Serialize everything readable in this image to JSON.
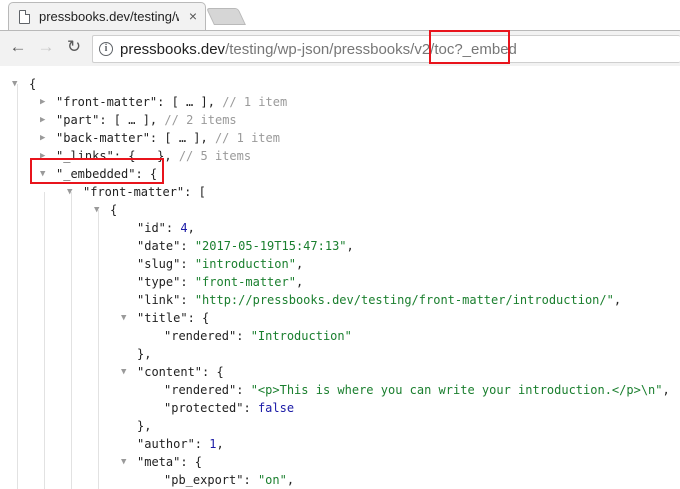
{
  "tab": {
    "title": "pressbooks.dev/testing/w",
    "close": "×"
  },
  "toolbar": {
    "back": "←",
    "forward": "→",
    "reload": "↻",
    "url_host": "pressbooks.dev",
    "url_path": "/testing/wp-json/pressbooks/v2/toc?_embed",
    "info": "i"
  },
  "json": {
    "open_brace": "{",
    "front_matter": {
      "key": "\"front-matter\"",
      "collapsed": ": [ … ], ",
      "comment": "// 1 item"
    },
    "part": {
      "key": "\"part\"",
      "collapsed": ": [ … ], ",
      "comment": "// 2 items"
    },
    "back_matter": {
      "key": "\"back-matter\"",
      "collapsed": ": [ … ], ",
      "comment": "// 1 item"
    },
    "links": {
      "key": "\"_links\"",
      "collapsed": ": { … }, ",
      "comment": "// 5 items"
    },
    "embedded": {
      "key": "\"_embedded\"",
      "open": ": {"
    },
    "embedded_front_matter": {
      "key": "\"front-matter\"",
      "open": ": ["
    },
    "item_open": "{",
    "id": {
      "key": "\"id\"",
      "value": "4"
    },
    "date": {
      "key": "\"date\"",
      "value": "\"2017-05-19T15:47:13\""
    },
    "slug": {
      "key": "\"slug\"",
      "value": "\"introduction\""
    },
    "type": {
      "key": "\"type\"",
      "value": "\"front-matter\""
    },
    "link": {
      "key": "\"link\"",
      "value": "\"http://pressbooks.dev/testing/front-matter/introduction/\""
    },
    "title": {
      "key": "\"title\"",
      "open": ": {",
      "rendered_key": "\"rendered\"",
      "rendered_value": "\"Introduction\"",
      "close": "},"
    },
    "content": {
      "key": "\"content\"",
      "open": ": {",
      "rendered_key": "\"rendered\"",
      "rendered_value": "\"<p>This is where you can write your introduction.</p>\\n\"",
      "protected_key": "\"protected\"",
      "protected_value": "false",
      "close": "},"
    },
    "author": {
      "key": "\"author\"",
      "value": "1"
    },
    "meta": {
      "key": "\"meta\"",
      "open": ": {",
      "pb_export_key": "\"pb_export\"",
      "pb_export_value": "\"on\""
    }
  },
  "colors": {
    "callout": "#e8141c",
    "string": "#1a7f2e",
    "number": "#1a1aa6",
    "comment": "#9a9a9a"
  },
  "icons": [
    "document-icon",
    "back-arrow-icon",
    "forward-arrow-icon",
    "reload-icon",
    "info-icon",
    "expand-triangle-icon",
    "collapse-triangle-icon"
  ]
}
